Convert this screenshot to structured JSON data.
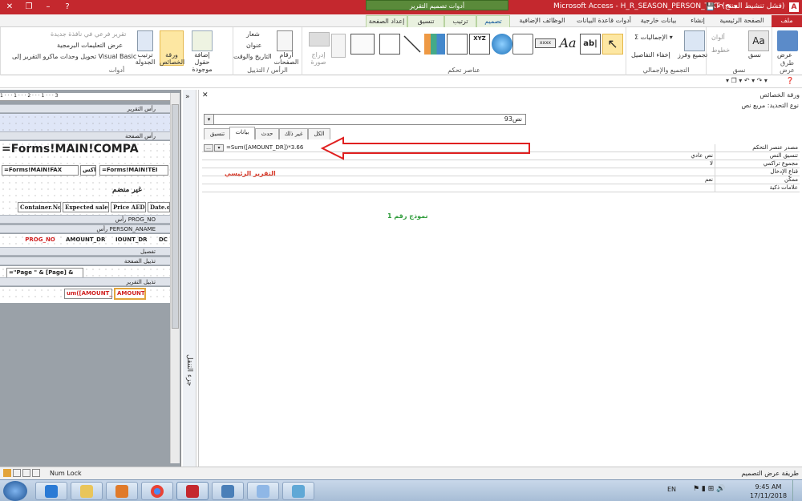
{
  "titlebar": {
    "title": "Microsoft Access - H_R_SEASON_PERSON_TIKT (فشل تنشيط المنتج)",
    "context_header": "أدوات تصميم التقرير",
    "app_letter": "A"
  },
  "tabs": [
    {
      "label": "ملف"
    },
    {
      "label": "الصفحة الرئيسية"
    },
    {
      "label": "إنشاء"
    },
    {
      "label": "بيانات خارجية"
    },
    {
      "label": "أدوات قاعدة البيانات"
    },
    {
      "label": "الوظائف الإضافية"
    },
    {
      "label": "تصميم"
    },
    {
      "label": "ترتيب"
    },
    {
      "label": "تنسيق"
    },
    {
      "label": "إعداد الصفحة"
    }
  ],
  "ribbon": {
    "views_group": {
      "label": "طرق عرض",
      "button": "عرض"
    },
    "themes_group": {
      "label": "نسق",
      "buttons": [
        "نسق",
        "ألوان",
        "خطوط"
      ]
    },
    "grouping_group": {
      "label": "التجميع والإجمالي",
      "buttons": [
        "تجميع وفرز",
        "الإجماليات",
        "إخفاء التفاصيل"
      ]
    },
    "controls_group": {
      "label": "عناصر تحكم",
      "insert_image": "إدراج صورة"
    },
    "header_footer_group": {
      "label": "الرأس / التذييل",
      "buttons": [
        "أرقام الصفحات",
        "شعار",
        "عنوان",
        "التاريخ والوقت"
      ]
    },
    "tools_group": {
      "label": "أدوات",
      "buttons": [
        "إضافة حقول موجودة",
        "ورقة الخصائص",
        "ترتيب الجدولة",
        "تقرير فرعي في نافذة جديدة",
        "عرض التعليمات البرمجية",
        "تحويل وحدات ماكرو التقرير إلى Visual Basic"
      ]
    }
  },
  "designer": {
    "ruler_marks": "1 · · · 1 · · · 2 · · · 1 · · · 3",
    "sections": {
      "report_header": "رأس التقرير",
      "page_header": "رأس الصفحة",
      "prog_no_header": "رأس PROG_NO",
      "person_header": "رأس PERSON_ANAME",
      "detail": "تفصيل",
      "page_footer": "تذييل الصفحة",
      "report_footer": "تذييل التقرير"
    },
    "controls": {
      "company": "=Forms!MAIN!COMPA",
      "fax_expr": "=Forms!MAIN!FAX",
      "fax_label": "فاكس",
      "tel_expr": "=Forms!MAIN!TEI",
      "unorg": "غير منضم",
      "col_container": "Container.No",
      "col_expected": "Expected sales",
      "col_price": "Price AED",
      "col_date": "Date.o",
      "prog_no": "PROG_NO",
      "amount_dr": "AMOUNT_DR",
      "amount_dr2": "IOUNT_DR",
      "dc": "DC",
      "page_expr": "=\"Page \" & [Page] &",
      "sum_expr": "um([AMOUNT_D",
      "sum_expr2": "AMOUNT_D"
    }
  },
  "nav_pane": {
    "label": "جزء التنقل"
  },
  "property_sheet": {
    "title": "ورقة الخصائص",
    "selection_type": "نوع التحديد:  مربع نص",
    "selected_control": "نص93",
    "tabs": [
      "تنسيق",
      "بيانات",
      "حدث",
      "غير ذلك",
      "الكل"
    ],
    "active_tab": "بيانات",
    "rows": [
      {
        "name": "مصدر عنصر التحكم",
        "value": "=Sum([AMOUNT_DR])*3.66"
      },
      {
        "name": "تنسيق النص",
        "value": "نص عادي"
      },
      {
        "name": "مجموع تراكمي",
        "value": "لا"
      },
      {
        "name": "قناع الإدخال",
        "value": ""
      },
      {
        "name": "ممكّن",
        "value": "نعم"
      },
      {
        "name": "علامات ذكية",
        "value": ""
      }
    ],
    "ellipsis": "...",
    "annotation_main_report": "التقرير الرئيسي",
    "annotation_form_no": "نموذج رقم 1"
  },
  "statusbar": {
    "view_name": "طريقة عرض التصميم",
    "num_lock": "Num Lock"
  },
  "taskbar": {
    "lang": "EN",
    "time": "9:45 AM",
    "date": "17/11/2018"
  },
  "colors": {
    "access_red": "#c4282e",
    "context_green": "#5a8a3a",
    "arrow_red": "#e02020"
  }
}
